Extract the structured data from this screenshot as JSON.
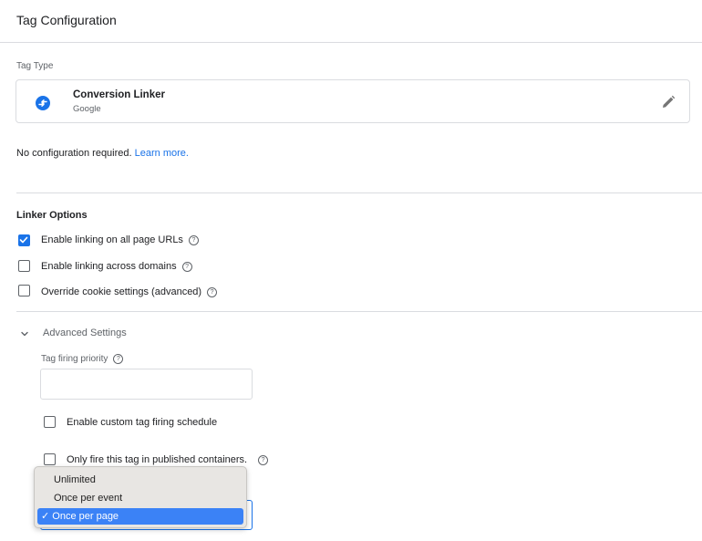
{
  "header": {
    "title": "Tag Configuration"
  },
  "tag_type": {
    "label": "Tag Type",
    "name": "Conversion Linker",
    "vendor": "Google",
    "icon": "conversion-linker-icon",
    "edit_icon": "pencil-icon"
  },
  "config_note": {
    "text": "No configuration required. ",
    "link": "Learn more."
  },
  "linker_options": {
    "title": "Linker Options",
    "items": [
      {
        "label": "Enable linking on all page URLs",
        "checked": true
      },
      {
        "label": "Enable linking across domains",
        "checked": false
      },
      {
        "label": "Override cookie settings (advanced)",
        "checked": false
      }
    ]
  },
  "advanced": {
    "title": "Advanced Settings",
    "priority_label": "Tag firing priority",
    "priority_value": "",
    "custom_schedule_label": "Enable custom tag firing schedule",
    "published_only_label": "Only fire this tag in published containers.",
    "firing_options": {
      "options": [
        "Unlimited",
        "Once per event",
        "Once per page"
      ],
      "selected": "Once per page",
      "check_mark": "✓"
    }
  },
  "colors": {
    "accent": "#1a73e8",
    "menu_selected": "#3b82f6",
    "menu_bg": "#e8e6e3"
  }
}
